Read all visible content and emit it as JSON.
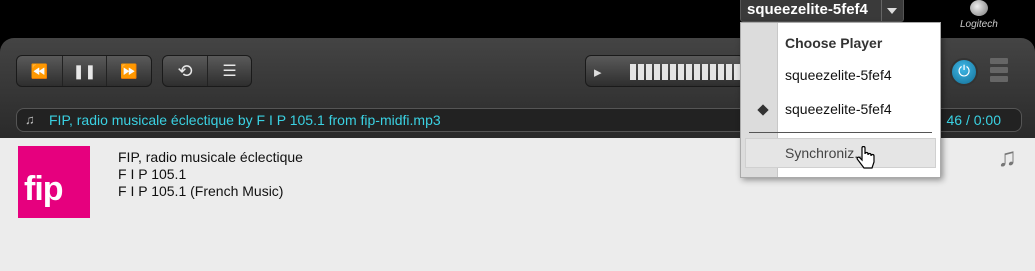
{
  "header": {
    "player_name": "squeezelite-5fef4",
    "logo_text": "Logitech"
  },
  "controls": {
    "rewind_icon": "⏪",
    "pause_icon": "❚❚",
    "forward_icon": "⏩",
    "repeat_icon": "⟲",
    "playlist_icon": "☰",
    "volume_icon": "🔈",
    "volume_level": 1.0,
    "power_icon": "⏻"
  },
  "now_playing": {
    "track_line": "FIP, radio musicale éclectique by F I P 105.1 from fip-midfi.mp3",
    "time": "46 / 0:00"
  },
  "details": {
    "title": "FIP, radio musicale éclectique",
    "artist": "F I P 105.1",
    "album": "F I P 105.1 (French Music)",
    "cover_text": "fip",
    "cover_color": "#e6007e"
  },
  "player_menu": {
    "heading": "Choose Player",
    "items": [
      "squeezelite-5fef4",
      "squeezelite-5fef4"
    ],
    "sync_label": "Synchroniz..."
  },
  "colors": {
    "accent": "#3ad1e2"
  }
}
